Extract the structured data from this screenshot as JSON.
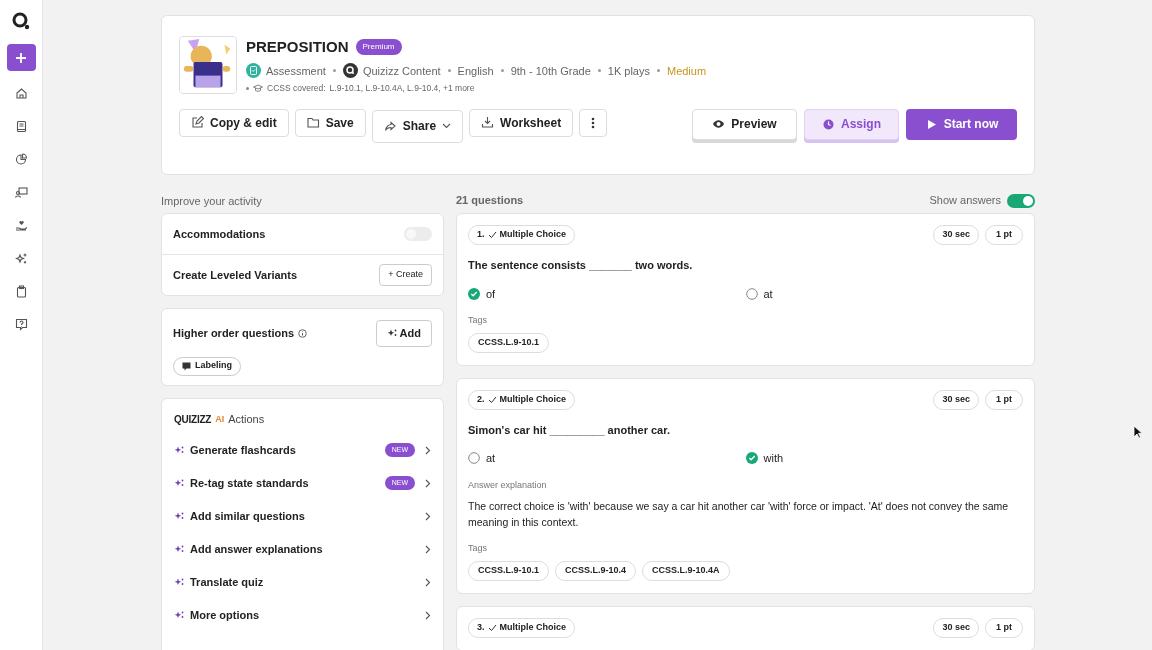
{
  "header": {
    "title": "PREPOSITION",
    "badge": "Premium",
    "meta": [
      {
        "kind": "type",
        "text": "Assessment"
      },
      {
        "kind": "author",
        "text": "Quizizz Content"
      },
      {
        "kind": "plain",
        "text": "English"
      },
      {
        "kind": "plain",
        "text": "9th - 10th Grade"
      },
      {
        "kind": "plain",
        "text": "1K plays"
      },
      {
        "kind": "difficulty",
        "text": "Medium"
      }
    ],
    "standards_label": "CCSS covered:",
    "standards": "L.9-10.1, L.9-10.4A, L.9-10.4, +1 more",
    "tools": [
      {
        "kind": "edit",
        "label": "Copy & edit"
      },
      {
        "kind": "save",
        "label": "Save"
      },
      {
        "kind": "share",
        "label": "Share"
      },
      {
        "kind": "worksheet",
        "label": "Worksheet"
      },
      {
        "kind": "more"
      }
    ],
    "actions": [
      {
        "kind": "outline",
        "label": "Preview"
      },
      {
        "kind": "soft",
        "label": "Assign"
      },
      {
        "kind": "primary",
        "label": "Start now"
      }
    ]
  },
  "improve": {
    "heading": "Improve your activity",
    "accommodations": {
      "label": "Accommodations",
      "on": false
    },
    "variants": {
      "label": "Create Leveled Variants",
      "button": "+ Create"
    },
    "higher_order": {
      "label": "Higher order questions",
      "button": "Add",
      "chips": [
        "Labeling"
      ]
    },
    "ai": {
      "brand": "QUIZIZZ",
      "brand_ai": "AI",
      "title": "Actions",
      "items": [
        {
          "label": "Generate flashcards",
          "badge": "NEW"
        },
        {
          "label": "Re-tag state standards",
          "badge": "NEW"
        },
        {
          "label": "Add similar questions"
        },
        {
          "label": "Add answer explanations"
        },
        {
          "label": "Translate quiz"
        },
        {
          "label": "More options"
        }
      ]
    }
  },
  "questions": {
    "count": "21 questions",
    "show_answers": {
      "label": "Show answers",
      "on": true
    },
    "items": [
      {
        "number": "1.",
        "type": "Multiple Choice",
        "time": "30 sec",
        "points": "1 pt",
        "text": "The sentence consists _______ two words.",
        "options": [
          {
            "text": "of",
            "correct": true
          },
          {
            "text": "at",
            "correct": false
          }
        ],
        "tags_label": "Tags",
        "tags": [
          "CCSS.L.9-10.1"
        ]
      },
      {
        "number": "2.",
        "type": "Multiple Choice",
        "time": "30 sec",
        "points": "1 pt",
        "text": "Simon's car hit _________ another car.",
        "options": [
          {
            "text": "at",
            "correct": false
          },
          {
            "text": "with",
            "correct": true
          }
        ],
        "explanation_label": "Answer explanation",
        "explanation": "The correct choice is 'with' because we say a car hit another car 'with' force or impact. 'At' does not convey the same meaning in this context.",
        "tags_label": "Tags",
        "tags": [
          "CCSS.L.9-10.1",
          "CCSS.L.9-10.4",
          "CCSS.L.9-10.4A"
        ]
      },
      {
        "number": "3.",
        "type": "Multiple Choice",
        "time": "30 sec",
        "points": "1 pt"
      }
    ]
  }
}
